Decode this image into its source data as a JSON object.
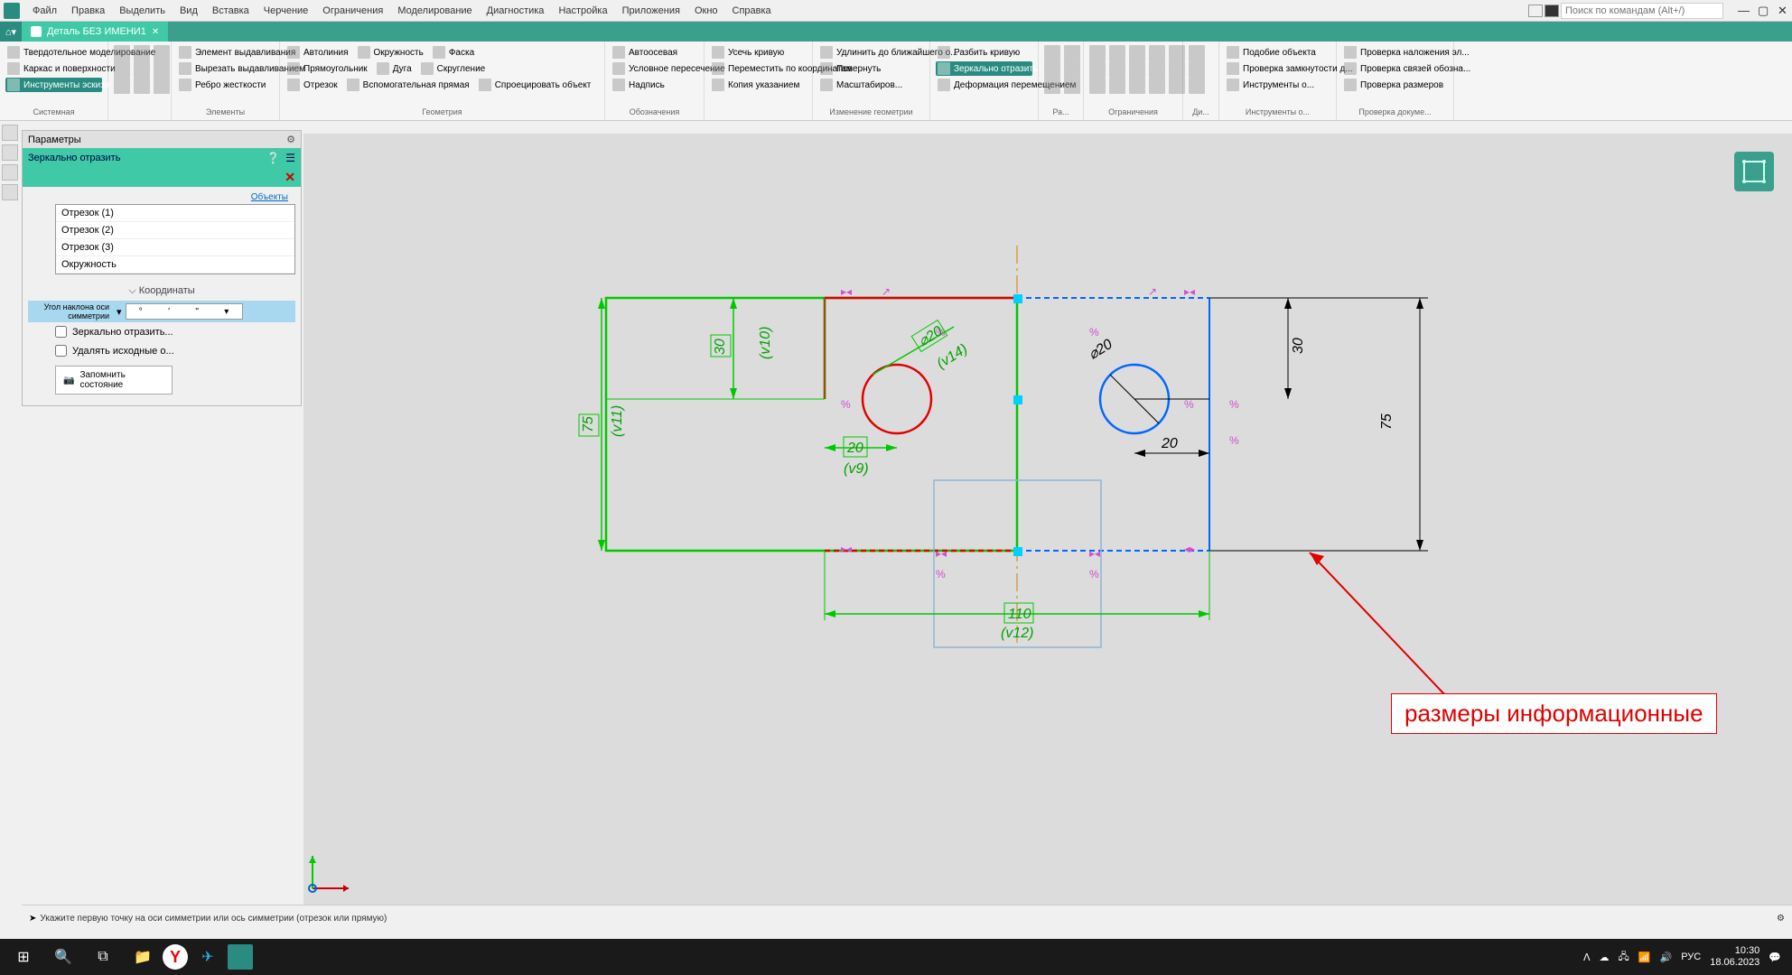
{
  "menu": {
    "items": [
      "Файл",
      "Правка",
      "Выделить",
      "Вид",
      "Вставка",
      "Черчение",
      "Ограничения",
      "Моделирование",
      "Диагностика",
      "Настройка",
      "Приложения",
      "Окно",
      "Справка"
    ],
    "search_placeholder": "Поиск по командам (Alt+/)"
  },
  "tab": {
    "title": "Деталь БЕЗ ИМЕНИ1"
  },
  "ribbon": {
    "groups": [
      {
        "label": "Системная",
        "items": [
          "Твердотельное моделирование",
          "Каркас и поверхности",
          "Инструменты эскиза"
        ]
      },
      {
        "label": "Элементы",
        "items": [
          "Элемент выдавливания",
          "Вырезать выдавливанием",
          "Ребро жесткости"
        ]
      },
      {
        "label": "Геометрия",
        "items": [
          [
            "Автолиния",
            "Окружность",
            "Фаска"
          ],
          [
            "Прямоугольник",
            "Дуга",
            "Скругление"
          ],
          [
            "Отрезок",
            "Вспомогательная прямая",
            "Спроецировать объект"
          ]
        ]
      },
      {
        "label": "Обозначения",
        "items": [
          "Автоосевая",
          "Условное пересечение",
          "Надпись"
        ]
      },
      {
        "label": "",
        "items": [
          "Усечь кривую",
          "Переместить по координатам",
          "Копия указанием"
        ]
      },
      {
        "label": "Изменение геометрии",
        "items": [
          "Удлинить до ближайшего о...",
          "Повернуть",
          "Масштабиров..."
        ]
      },
      {
        "label": "",
        "items": [
          "Разбить кривую",
          "Зеркально отразить",
          "Деформация перемещением"
        ]
      },
      {
        "label": "Ра...",
        "icons": true
      },
      {
        "label": "Ограничения",
        "icons": true
      },
      {
        "label": "Ди...",
        "icons": true
      },
      {
        "label": "Инструменты о...",
        "items": [
          "Подобие объекта",
          "Проверка замкнутости д...",
          "Инструменты о..."
        ]
      },
      {
        "label": "Проверка докуме...",
        "items": [
          "Проверка наложения эл...",
          "Проверка связей обозна...",
          "Проверка размеров"
        ]
      }
    ]
  },
  "params": {
    "panel_title": "Параметры",
    "title": "Зеркально отразить",
    "objects_label": "Объекты",
    "objects": [
      "Отрезок (1)",
      "Отрезок (2)",
      "Отрезок (3)",
      "Окружность"
    ],
    "coords_label": "Координаты",
    "angle_label": "Угол наклона оси симметрии",
    "check1": "Зеркально отразить...",
    "check2": "Удалять исходные о...",
    "remember": "Запомнить состояние"
  },
  "dimensions": {
    "d30_left": "30",
    "d75_left": "75",
    "d20_left": "20",
    "d20_dia_left": "⌀20",
    "d20_dia_right": "⌀20",
    "d110": "110",
    "d30_right": "30",
    "d75_right": "75",
    "d20_right": "20",
    "v9": "(v9)",
    "v10": "(v10)",
    "v11": "(v11)",
    "v12": "(v12)",
    "v14": "(v14)"
  },
  "annotation": {
    "text": "размеры информационные"
  },
  "statusbar": {
    "text": "Укажите первую точку на оси симметрии или ось симметрии (отрезок или прямую)"
  },
  "tray": {
    "lang": "РУС",
    "time": "10:30",
    "date": "18.06.2023"
  }
}
